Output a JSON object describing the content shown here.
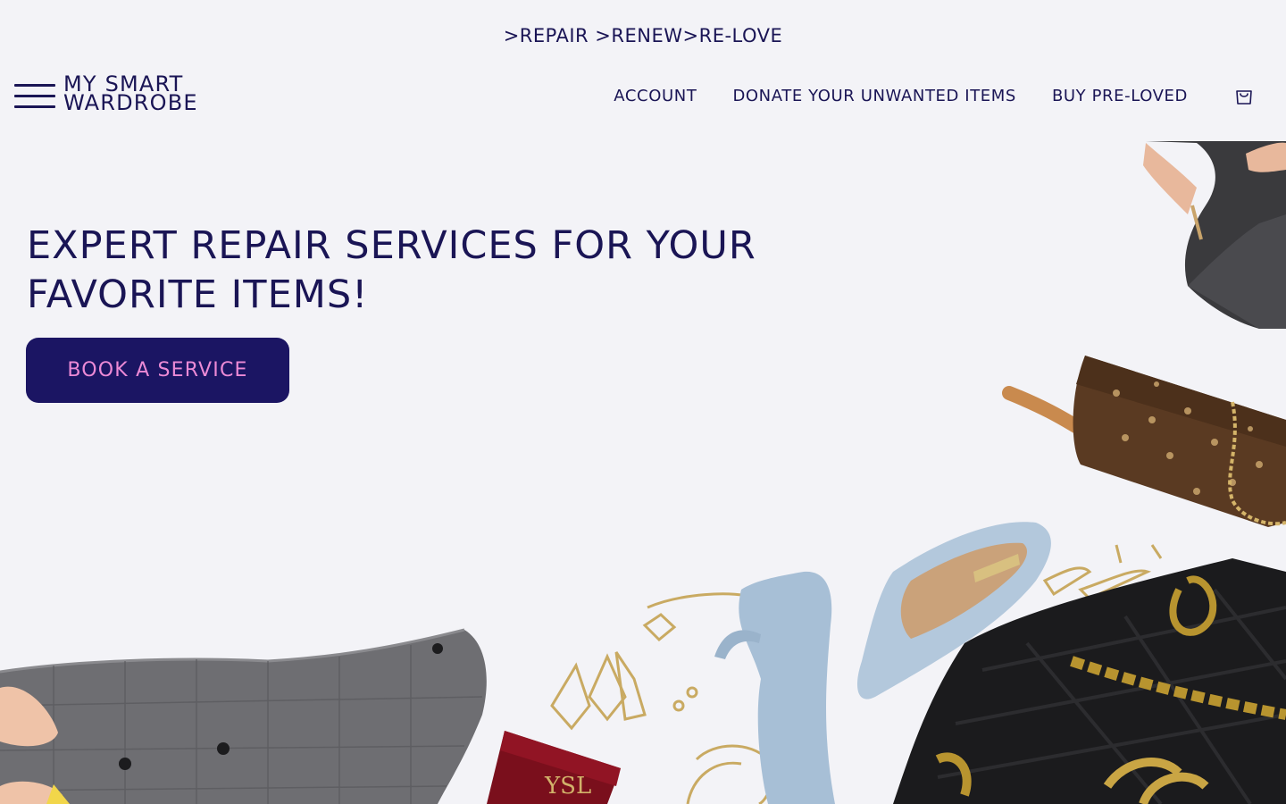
{
  "announcement": {
    "text": ">REPAIR >RENEW>RE-LOVE"
  },
  "header": {
    "logo_line1": "MY SMART",
    "logo_line2": "WARDROBE",
    "nav": [
      {
        "label": "ACCOUNT"
      },
      {
        "label": "DONATE YOUR UNWANTED ITEMS"
      },
      {
        "label": "BUY PRE-LOVED"
      }
    ]
  },
  "hero": {
    "title_line1": "EXPERT REPAIR SERVICES FOR YOUR",
    "title_line2": "FAVORITE ITEMS!",
    "cta_label": "BOOK A SERVICE"
  },
  "colors": {
    "background": "#f3f3f7",
    "brand_navy": "#1a1555",
    "button_bg": "#1b1563",
    "button_text": "#ec8ad6"
  },
  "icons": {
    "menu": "hamburger-menu-icon",
    "cart": "shopping-bag-icon"
  }
}
